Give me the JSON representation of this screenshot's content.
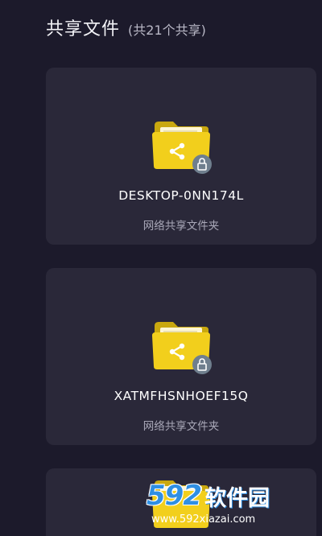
{
  "header": {
    "title": "共享文件",
    "count": "(共21个共享)"
  },
  "shares": [
    {
      "name": "DESKTOP-0NN174L",
      "type": "网络共享文件夹"
    },
    {
      "name": "XATMFHSNHOEF15Q",
      "type": "网络共享文件夹"
    },
    {
      "name": "",
      "type": ""
    }
  ],
  "icons": {
    "folder": "shared-folder-icon",
    "share": "share-icon",
    "lock": "lock-icon"
  },
  "colors": {
    "background": "#1c1a2b",
    "card": "#2a2839",
    "folder": "#f2cf1c",
    "lock_badge": "#6f7f8e"
  },
  "watermark": {
    "brand_number": "592",
    "brand_text": "软件园",
    "url": "www.592xiazai.com"
  }
}
